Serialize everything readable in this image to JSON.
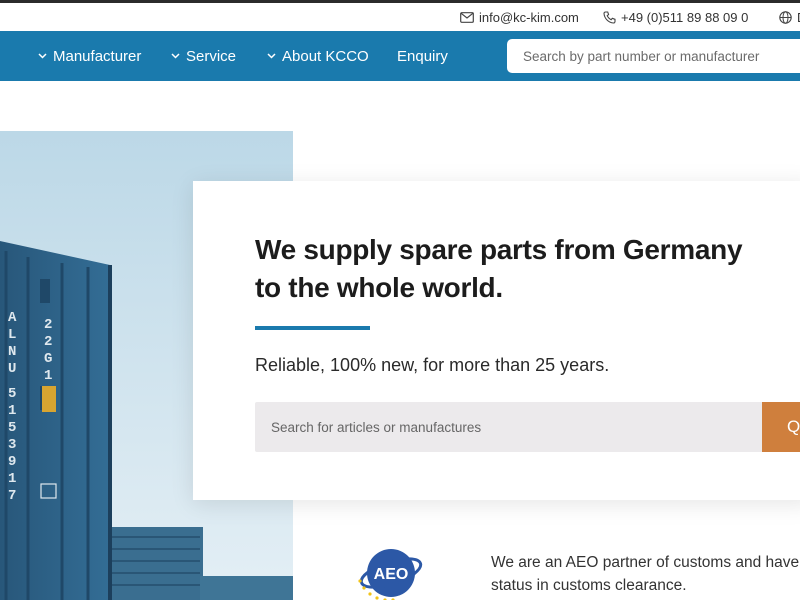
{
  "topbar": {
    "email": "info@kc-kim.com",
    "phone": "+49 (0)511 89 88 09 0",
    "language": "D",
    "icons": [
      "mail-icon",
      "phone-icon",
      "globe-icon"
    ]
  },
  "nav": {
    "items": [
      {
        "label": "Manufacturer",
        "has_dropdown": true
      },
      {
        "label": "Service",
        "has_dropdown": true
      },
      {
        "label": "About KCCO",
        "has_dropdown": true
      },
      {
        "label": "Enquiry",
        "has_dropdown": false
      }
    ],
    "search_placeholder": "Search by part number or manufacturer"
  },
  "hero": {
    "headline_line1": "We supply spare parts from Germany",
    "headline_line2": "to the whole world.",
    "tagline": "Reliable, 100% new, for more than 25 years.",
    "search_placeholder": "Search for articles or manufactures",
    "search_button_label": "Q"
  },
  "aeo": {
    "logo_text": "AEO",
    "text_line1": "We are an AEO partner of customs and have",
    "text_line2": "status in customs clearance."
  },
  "colors": {
    "brand_blue": "#1a7aad",
    "accent_orange": "#cf7f3d",
    "search_bg": "#eceaec"
  }
}
